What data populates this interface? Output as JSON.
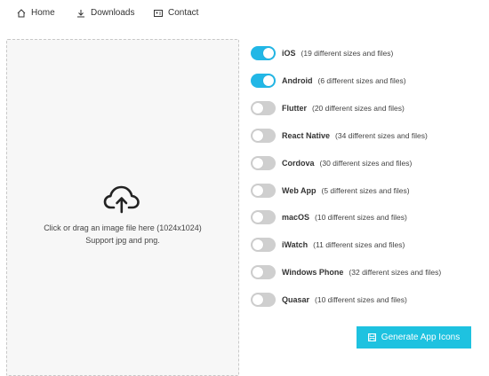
{
  "nav": {
    "home_label": "Home",
    "downloads_label": "Downloads",
    "contact_label": "Contact"
  },
  "dropzone": {
    "line1": "Click or drag an image file here (1024x1024)",
    "line2": "Support jpg and png.",
    "icon": "upload-cloud-icon"
  },
  "platforms": [
    {
      "name": "iOS",
      "detail": "(19 different sizes and files)",
      "enabled": true
    },
    {
      "name": "Android",
      "detail": "(6 different sizes and files)",
      "enabled": true
    },
    {
      "name": "Flutter",
      "detail": "(20 different sizes and files)",
      "enabled": false
    },
    {
      "name": "React Native",
      "detail": "(34 different sizes and files)",
      "enabled": false
    },
    {
      "name": "Cordova",
      "detail": "(30 different sizes and files)",
      "enabled": false
    },
    {
      "name": "Web App",
      "detail": "(5 different sizes and files)",
      "enabled": false
    },
    {
      "name": "macOS",
      "detail": "(10 different sizes and files)",
      "enabled": false
    },
    {
      "name": "iWatch",
      "detail": "(11 different sizes and files)",
      "enabled": false
    },
    {
      "name": "Windows Phone",
      "detail": "(32 different sizes and files)",
      "enabled": false
    },
    {
      "name": "Quasar",
      "detail": "(10 different sizes and files)",
      "enabled": false
    }
  ],
  "generate_button": {
    "label": "Generate App Icons"
  },
  "colors": {
    "accent": "#22b7e6",
    "button": "#1ec2e0",
    "toggle_off": "#cfcfcf"
  }
}
